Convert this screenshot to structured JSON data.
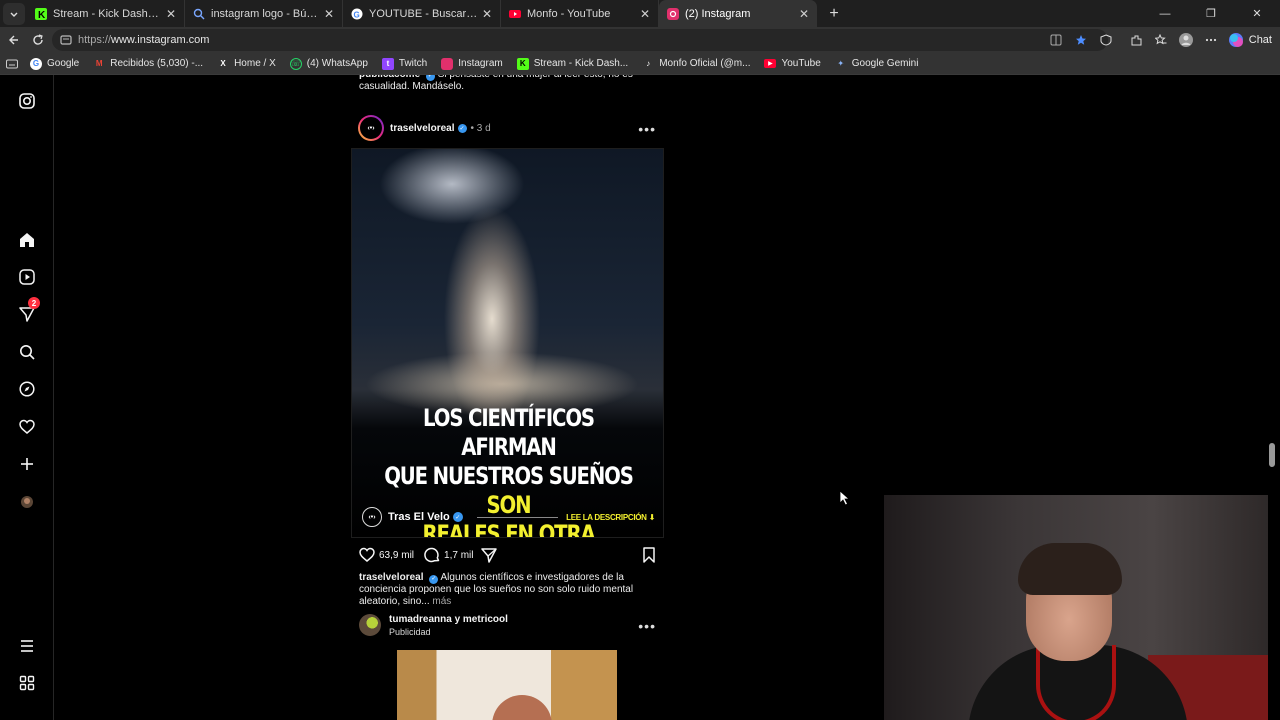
{
  "tabs": [
    {
      "title": "Stream - Kick Dashboard",
      "icon": "kick-icon",
      "color": "#53fc18"
    },
    {
      "title": "instagram logo - Búsqueda",
      "icon": "search-icon",
      "color": "#7aa7ff"
    },
    {
      "title": "YOUTUBE - Buscar con Google",
      "icon": "google-icon",
      "color": "#ffffff"
    },
    {
      "title": "Monfo - YouTube",
      "icon": "youtube-icon",
      "color": "#ff0033"
    },
    {
      "title": "(2) Instagram",
      "icon": "instagram-icon",
      "color": "#e1306c"
    }
  ],
  "address": {
    "scheme": "https://",
    "host": "www.instagram.com"
  },
  "toolbar": {
    "chat_label": "Chat"
  },
  "bookmarks": [
    {
      "label": "Google",
      "icon": "google-icon"
    },
    {
      "label": "Recibidos (5,030) -...",
      "icon": "gmail-icon"
    },
    {
      "label": "Home / X",
      "icon": "x-icon"
    },
    {
      "label": "(4) WhatsApp",
      "icon": "whatsapp-icon"
    },
    {
      "label": "Twitch",
      "icon": "twitch-icon"
    },
    {
      "label": "Instagram",
      "icon": "instagram-icon"
    },
    {
      "label": "Stream - Kick Dash...",
      "icon": "kick-icon"
    },
    {
      "label": "Monfo Oficial (@m...",
      "icon": "tiktok-icon"
    },
    {
      "label": "YouTube",
      "icon": "youtube-icon"
    },
    {
      "label": "Google Gemini",
      "icon": "gemini-icon"
    }
  ],
  "sidebar": {
    "notification_count": "2"
  },
  "previous_post": {
    "username": "publicacome",
    "caption": "Si pensaste en una mujer al leer esto, no es casualidad. Mandáselo."
  },
  "post": {
    "username": "traselveloreal",
    "time": "3 d",
    "avatar_text": "‹•›",
    "headline_white_1": "LOS CIENTÍFICOS AFIRMAN",
    "headline_white_2": "QUE NUESTROS SUEÑOS",
    "headline_yellow_2": "SON",
    "headline_yellow_3": "REALES EN OTRA REALIDAD",
    "media_brand": "Tras El Velo",
    "media_cta": "LEE LA DESCRIPCIÓN ⬇",
    "likes": "63,9 mil",
    "comments": "1,7 mil",
    "caption_username": "traselveloreal",
    "caption": "Algunos científicos e investigadores de la conciencia proponen que los sueños no son solo ruido mental aleatorio, sino...",
    "more": "más"
  },
  "ad_post": {
    "username": "tumadreanna y metricool",
    "label": "Publicidad"
  }
}
